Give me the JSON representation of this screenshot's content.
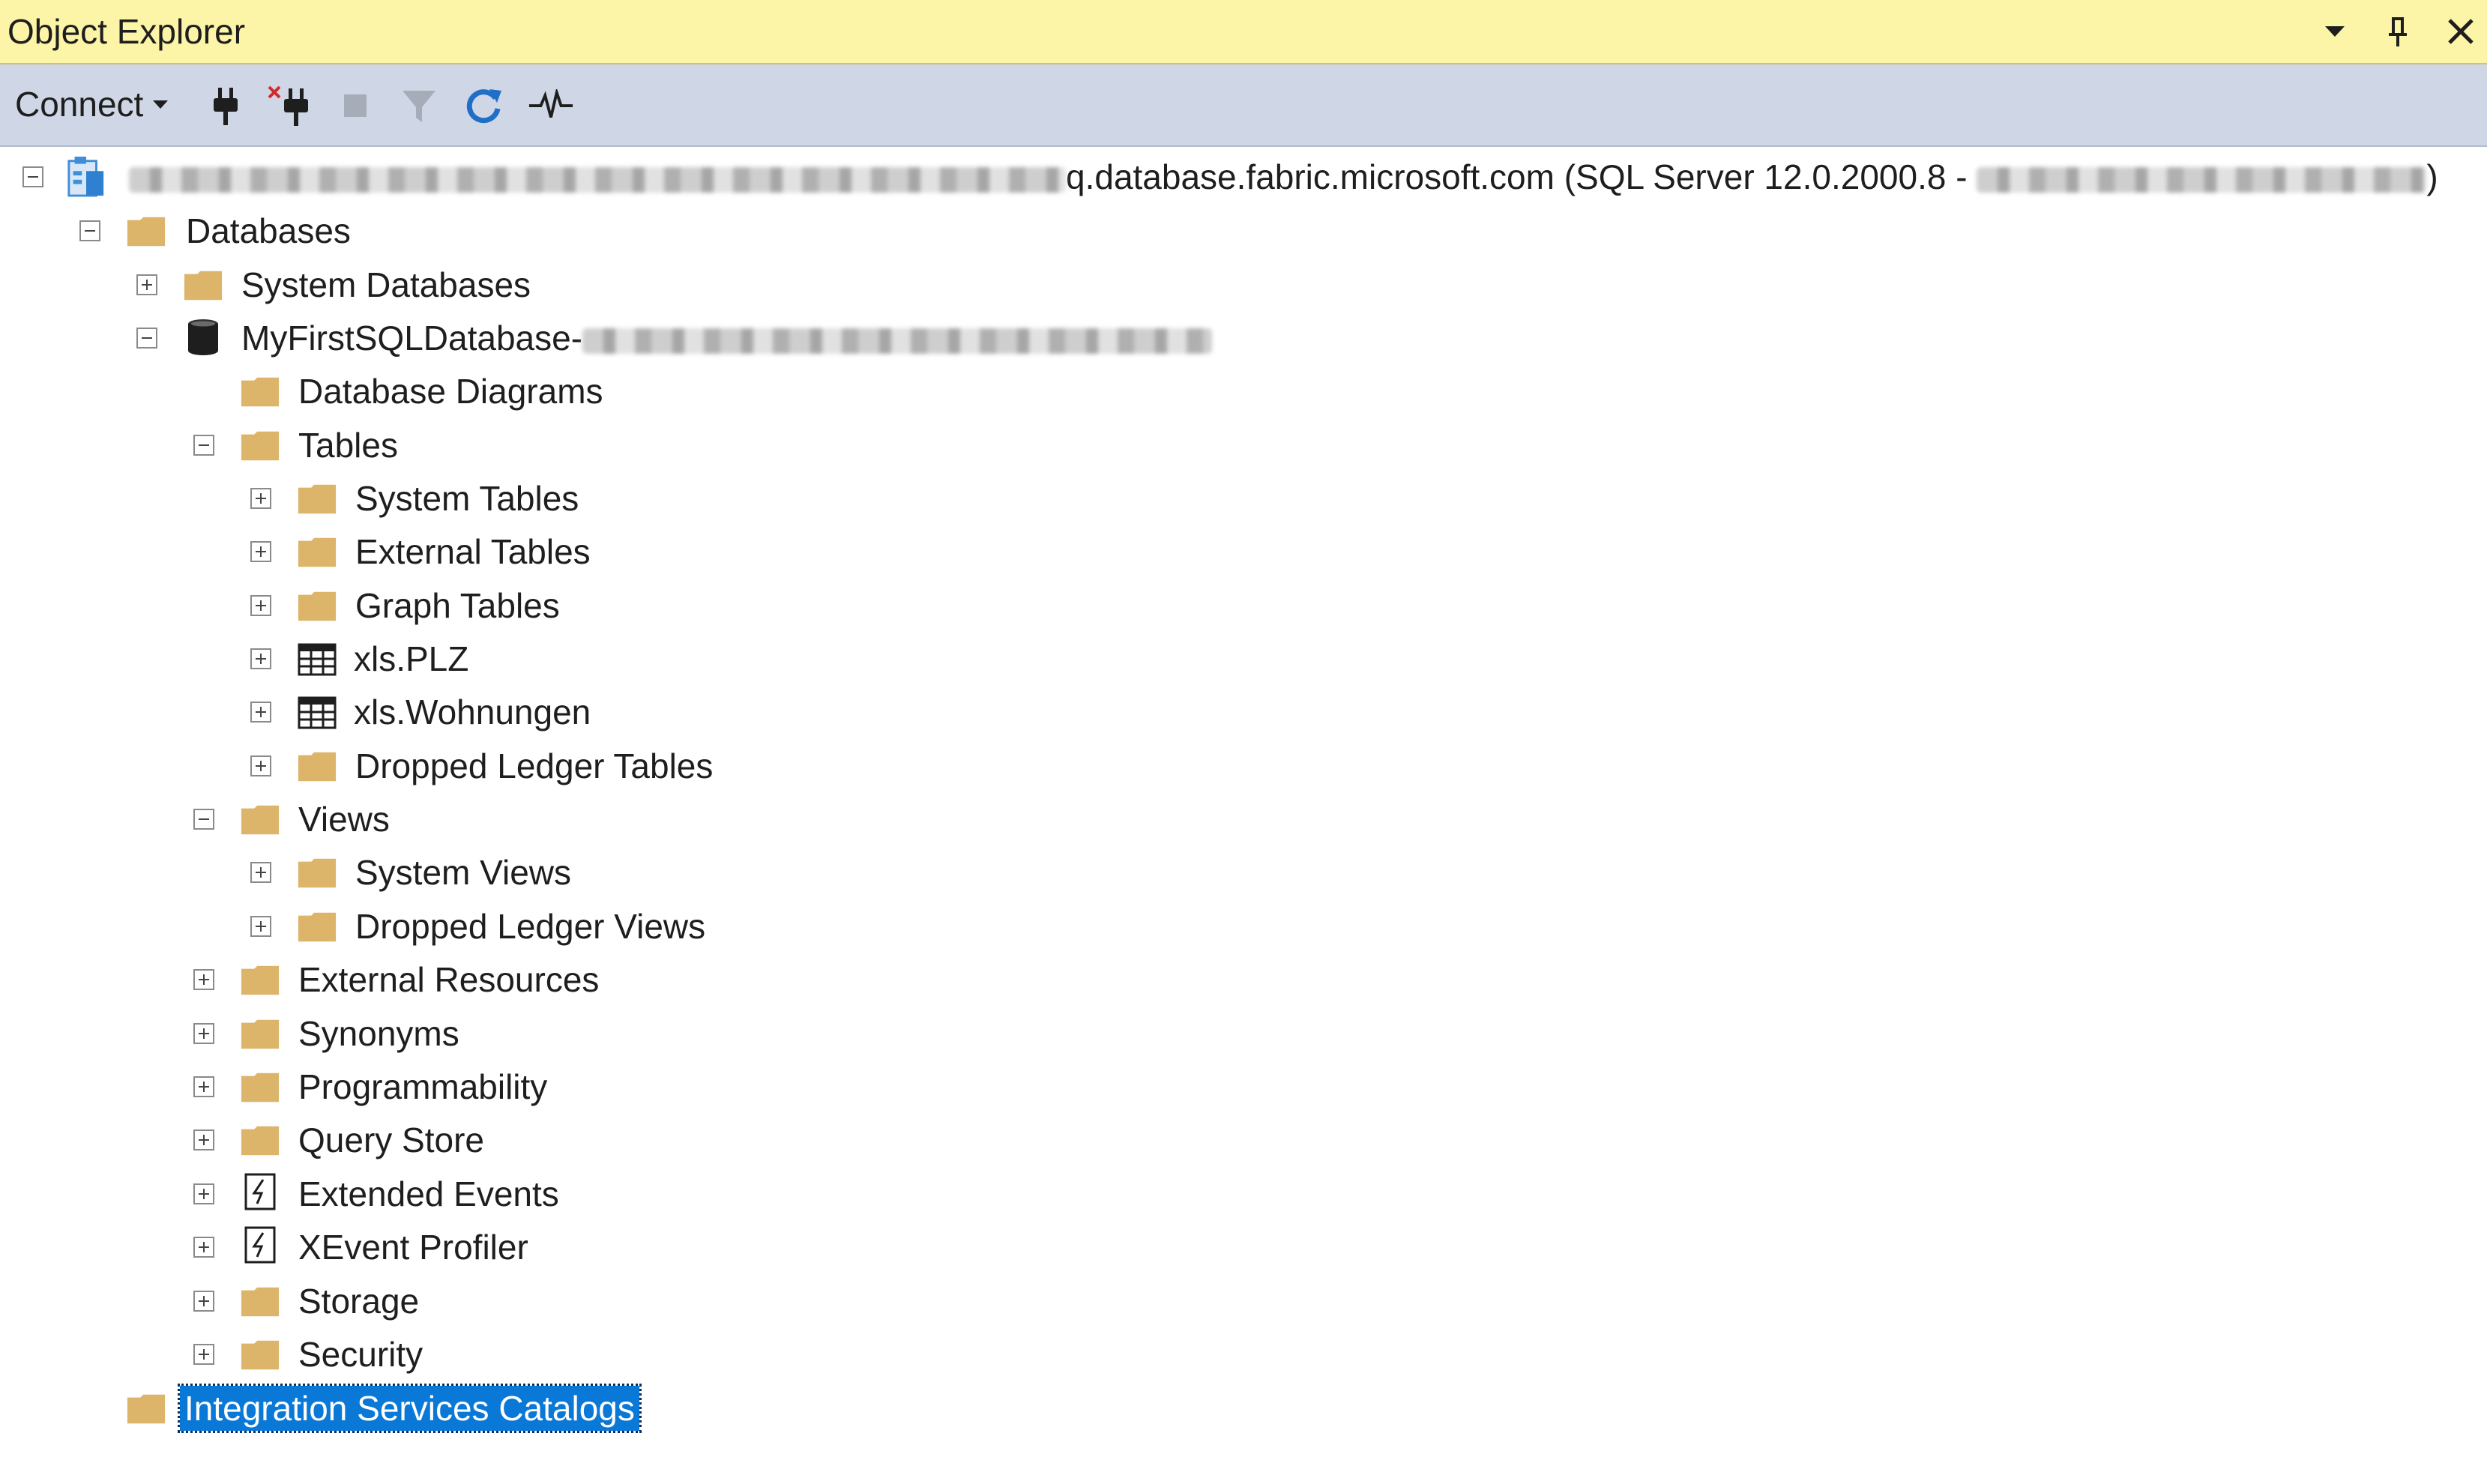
{
  "titlebar": {
    "title": "Object Explorer",
    "controls": [
      {
        "name": "dropdown-arrow-icon"
      },
      {
        "name": "pin-icon"
      },
      {
        "name": "close-icon"
      }
    ]
  },
  "toolbar": {
    "connect_label": "Connect",
    "buttons": [
      {
        "name": "connect-plug-icon"
      },
      {
        "name": "disconnect-plug-icon"
      },
      {
        "name": "stop-icon"
      },
      {
        "name": "filter-icon"
      },
      {
        "name": "refresh-icon"
      },
      {
        "name": "activity-monitor-icon"
      }
    ]
  },
  "server": {
    "label_visible": "q.database.fabric.microsoft.com (SQL Server 12.0.2000.8 - ",
    "label_end": ")"
  },
  "tree": {
    "databases": "Databases",
    "system_databases": "System Databases",
    "database_name": "MyFirstSQLDatabase-",
    "database_diagrams": "Database Diagrams",
    "tables": "Tables",
    "system_tables": "System Tables",
    "external_tables": "External Tables",
    "graph_tables": "Graph Tables",
    "table_plz": "xls.PLZ",
    "table_wohnungen": "xls.Wohnungen",
    "dropped_ledger_tables": "Dropped Ledger Tables",
    "views": "Views",
    "system_views": "System Views",
    "dropped_ledger_views": "Dropped Ledger Views",
    "external_resources": "External Resources",
    "synonyms": "Synonyms",
    "programmability": "Programmability",
    "query_store": "Query Store",
    "extended_events": "Extended Events",
    "xevent_profiler": "XEvent Profiler",
    "storage": "Storage",
    "security": "Security",
    "integration_services": "Integration Services Catalogs"
  },
  "colors": {
    "titlebar_bg": "#fcf4a7",
    "toolbar_bg": "#cfd6e5",
    "folder": "#dcb46a",
    "selection": "#0a78d7"
  }
}
